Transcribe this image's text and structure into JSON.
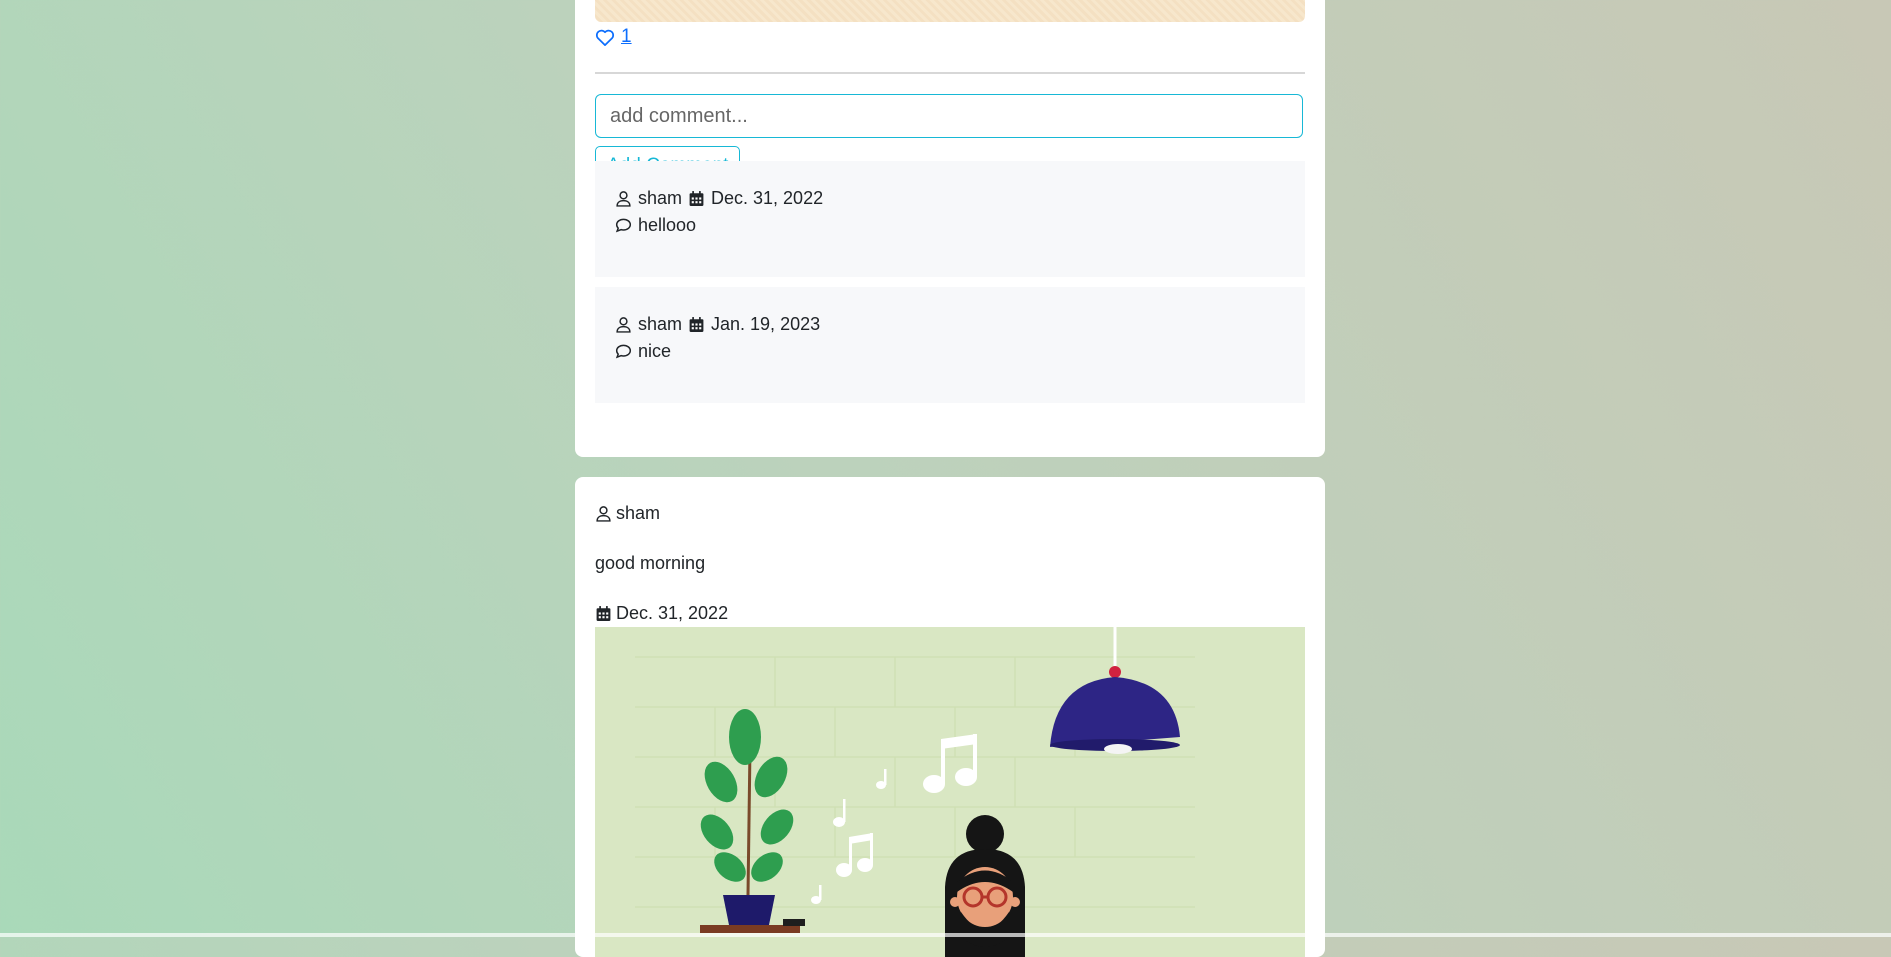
{
  "post1": {
    "likes": "1",
    "comment_placeholder": "add comment...",
    "add_comment_label": "Add Comment",
    "comments": [
      {
        "author": "sham",
        "date": "Dec. 31, 2022",
        "text": "hellooo"
      },
      {
        "author": "sham",
        "date": "Jan. 19, 2023",
        "text": "nice"
      }
    ]
  },
  "post2": {
    "author": "sham",
    "text": "good morning",
    "date": "Dec. 31, 2022"
  },
  "icons": {
    "heart": "heart-icon",
    "user": "user-icon",
    "calendar": "calendar-icon",
    "comment": "comment-icon"
  },
  "colors": {
    "like": "#0d6efd",
    "accent": "#17b8d6",
    "comment_bg": "#f7f8fa"
  }
}
